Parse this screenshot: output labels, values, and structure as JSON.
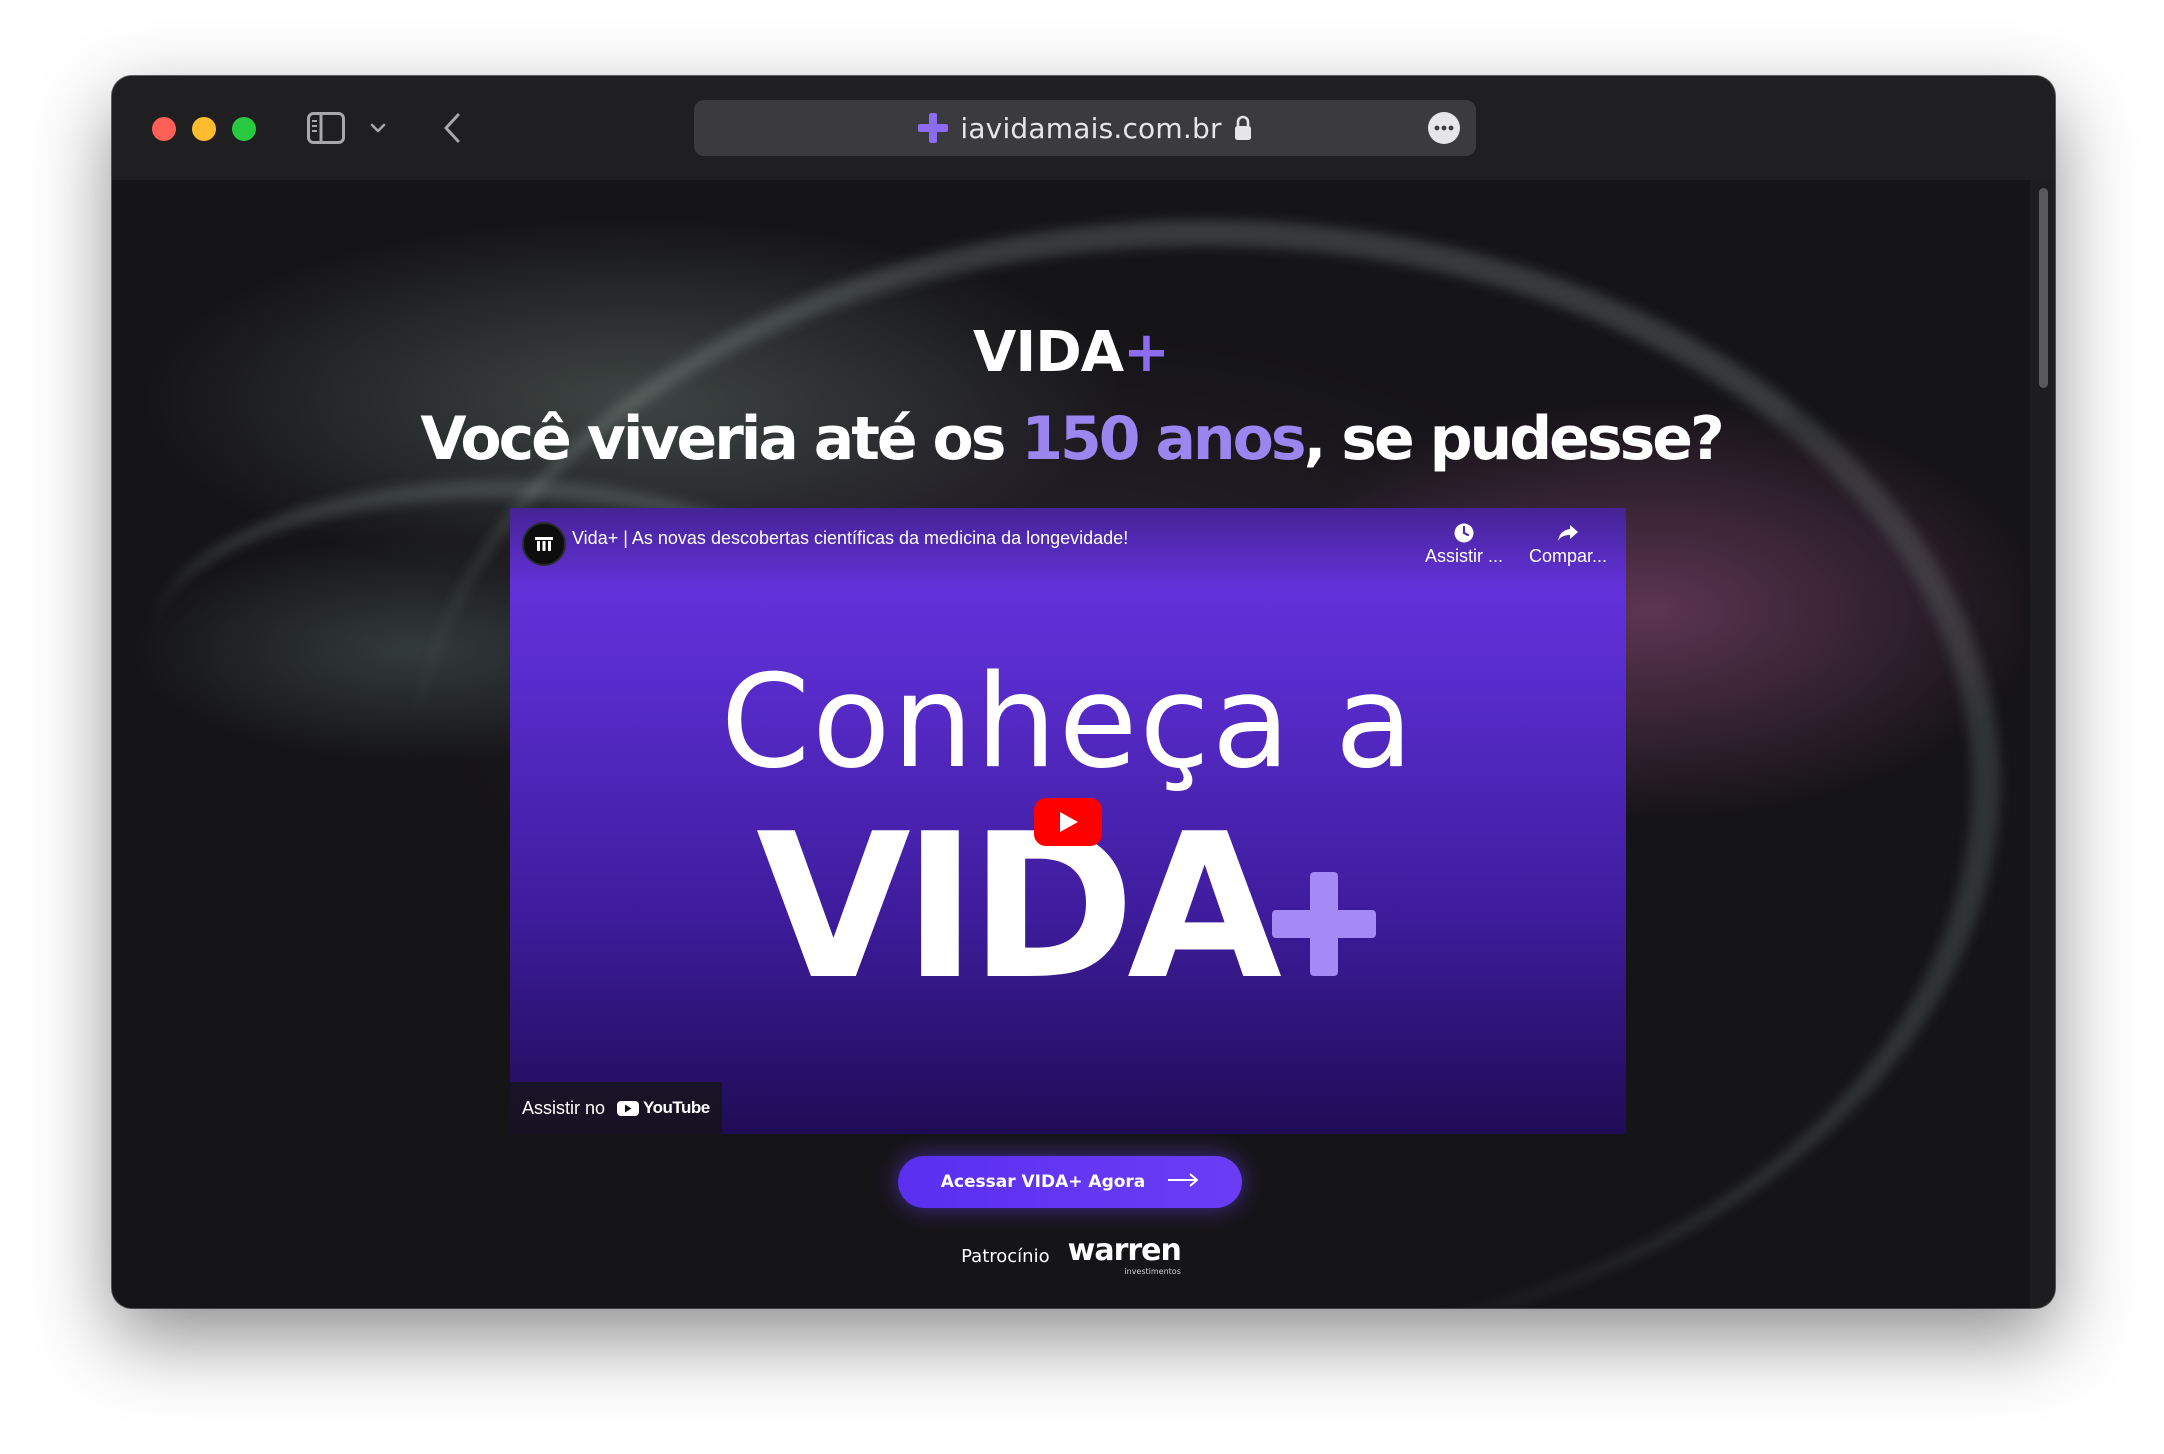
{
  "browser": {
    "url": "iavidamais.com.br",
    "site_icon": "plus-icon",
    "accent_color": "#8c6cf0"
  },
  "page": {
    "brand": "VIDA",
    "brand_plus": "+",
    "headline_before": "Você viveria até os ",
    "headline_highlight": "150 anos",
    "headline_after": ", se pudesse?",
    "highlight_color": "#9b86f0"
  },
  "video": {
    "title": "Vida+ | As novas descobertas científicas da medicina da longevidade!",
    "watch_later_label": "Assistir ...",
    "share_label": "Compar...",
    "thumb_line1": "Conheça a",
    "thumb_line2": "VIDA",
    "watch_on_label": "Assistir no",
    "youtube_label": "YouTube",
    "gradient_top": "#6a35e4",
    "gradient_bottom": "#1f0c55"
  },
  "cta": {
    "label": "Acessar VIDA+ Agora",
    "color": "#5b2ff0"
  },
  "sponsor": {
    "label": "Patrocínio",
    "name": "warren",
    "sub": "investimentos"
  }
}
